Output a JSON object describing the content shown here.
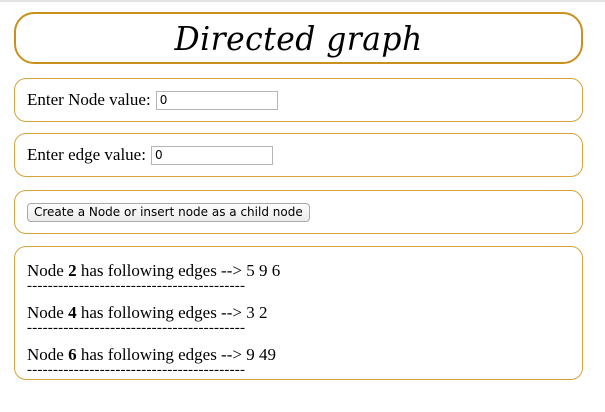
{
  "page": {
    "title": "Directed graph"
  },
  "node_field": {
    "label": "Enter Node value:",
    "value": "0"
  },
  "edge_field": {
    "label": "Enter edge value:",
    "value": "0"
  },
  "create_button": {
    "label": "Create a Node or insert node as a child node"
  },
  "output": {
    "entries": [
      {
        "prefix": "Node ",
        "node": "2",
        "suffix": " has following edges --> 5 9 6",
        "separator": "------------------------------------------"
      },
      {
        "prefix": "Node ",
        "node": "4",
        "suffix": " has following edges --> 3 2",
        "separator": "------------------------------------------"
      },
      {
        "prefix": "Node ",
        "node": "6",
        "suffix": " has following edges --> 9 49",
        "separator": "------------------------------------------"
      }
    ]
  },
  "colors": {
    "border": "#d9a23a",
    "title_border": "#c9901e"
  }
}
